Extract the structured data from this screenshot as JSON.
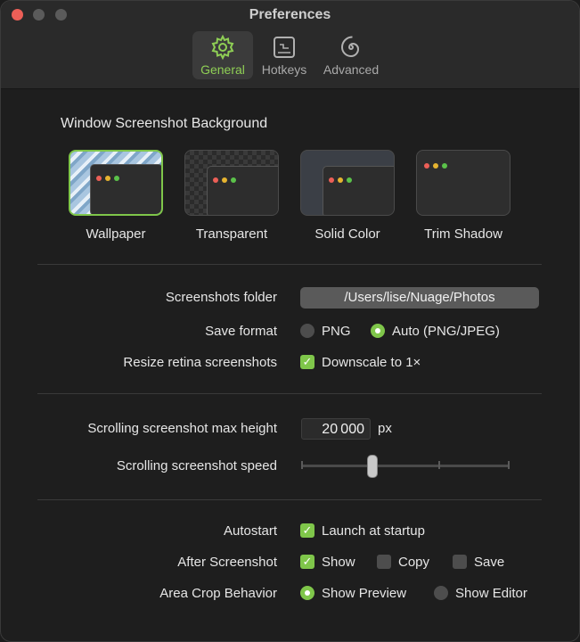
{
  "window": {
    "title": "Preferences"
  },
  "tabs": [
    {
      "id": "general",
      "label": "General",
      "icon": "gear-icon",
      "active": true
    },
    {
      "id": "hotkeys",
      "label": "Hotkeys",
      "icon": "keyboard-shortcut-icon",
      "active": false
    },
    {
      "id": "advanced",
      "label": "Advanced",
      "icon": "spiral-icon",
      "active": false
    }
  ],
  "background": {
    "title": "Window Screenshot Background",
    "options": [
      {
        "label": "Wallpaper",
        "selected": true
      },
      {
        "label": "Transparent",
        "selected": false
      },
      {
        "label": "Solid Color",
        "selected": false
      },
      {
        "label": "Trim Shadow",
        "selected": false
      }
    ]
  },
  "folder": {
    "label": "Screenshots folder",
    "value": "/Users/lise/Nuage/Photos"
  },
  "save_format": {
    "label": "Save format",
    "options": [
      "PNG",
      "Auto (PNG/JPEG)"
    ],
    "selected": "Auto (PNG/JPEG)"
  },
  "retina": {
    "label": "Resize retina screenshots",
    "checkbox_label": "Downscale to 1×",
    "checked": true
  },
  "scroll_height": {
    "label": "Scrolling screenshot max height",
    "value": "20 000",
    "unit": "px"
  },
  "scroll_speed": {
    "label": "Scrolling screenshot speed",
    "level": 0.33
  },
  "autostart": {
    "label": "Autostart",
    "checkbox_label": "Launch at startup",
    "checked": true
  },
  "after_screenshot": {
    "label": "After Screenshot",
    "options": [
      {
        "label": "Show",
        "checked": true
      },
      {
        "label": "Copy",
        "checked": false
      },
      {
        "label": "Save",
        "checked": false
      }
    ]
  },
  "area_crop": {
    "label": "Area Crop Behavior",
    "options": [
      "Show Preview",
      "Show Editor"
    ],
    "selected": "Show Preview"
  },
  "colors": {
    "accent": "#7fc64a",
    "close": "#ec5f57"
  }
}
